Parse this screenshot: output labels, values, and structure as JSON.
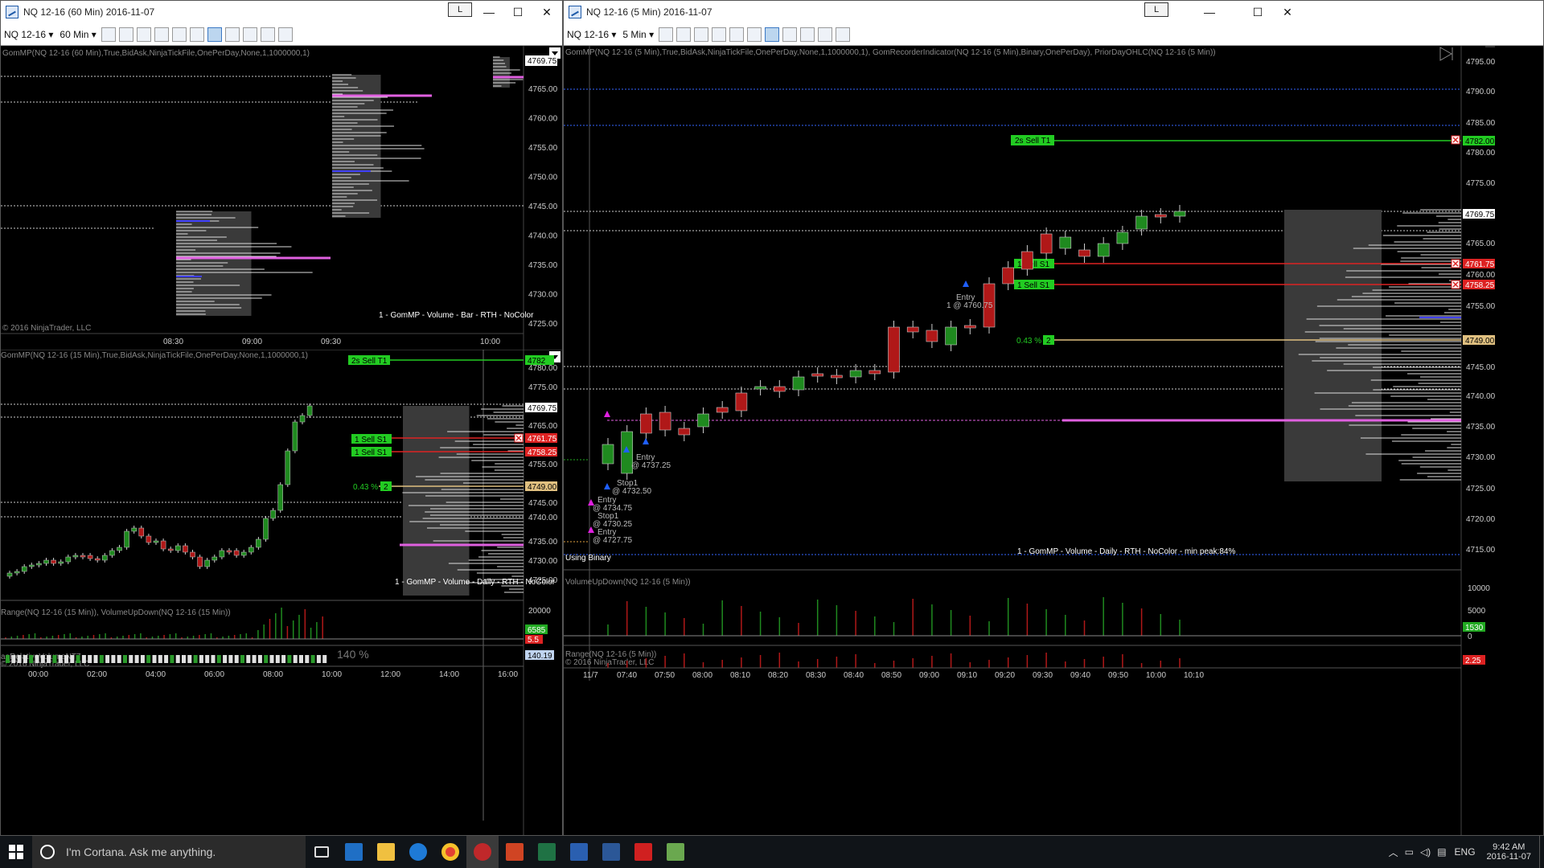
{
  "left_window": {
    "title": "NQ 12-16 (60 Min)  2016-11-07",
    "l_button": "L",
    "controls": {
      "min": "—",
      "max": "☐",
      "close": "✕"
    },
    "toolbar": {
      "instrument": "NQ 12-16",
      "interval": "60 Min"
    }
  },
  "right_window": {
    "title": "NQ 12-16 (5 Min)  2016-11-07",
    "l_button": "L",
    "controls": {
      "min": "—",
      "max": "☐",
      "close": "✕"
    },
    "toolbar": {
      "instrument": "NQ 12-16",
      "interval": "5 Min"
    }
  },
  "chart_60": {
    "indicator_label": "GomMP(NQ 12-16 (60 Min),True,BidAsk,NinjaTickFile,OnePerDay,None,1,1000000,1)",
    "copyright": "© 2016 NinjaTrader, LLC",
    "legend": "1 - GomMP  - Volume - Bar - RTH - NoColor",
    "price_labels": [
      "4765.00",
      "4760.00",
      "4755.00",
      "4750.00",
      "4745.00",
      "4740.00",
      "4735.00",
      "4730.00",
      "4725.00"
    ],
    "last_price": "4769.75",
    "time_labels": [
      "08:30",
      "09:00",
      "09:30",
      "10:00"
    ]
  },
  "chart_15": {
    "indicator_label": "GomMP(NQ 12-16 (15 Min),True,BidAsk,NinjaTickFile,OnePerDay,None,1,1000000,1)",
    "legend": "1 - GomMP  - Volume - Daily - RTH - NoColor",
    "price_labels": [
      "4780.00",
      "4775.00",
      "4765.00",
      "4755.00",
      "4745.00",
      "4740.00",
      "4735.00",
      "4730.00",
      "4725.00"
    ],
    "order_sell_t1": "2s  Sell T1",
    "order_sell_s1_a": "1  Sell S1",
    "order_sell_s1_b": "1  Sell S1",
    "tag_target": "4782",
    "tag_last": "4769.75",
    "tag_s1a": "4761.75",
    "tag_s1b": "4758.25",
    "tag_prev": "4749.00",
    "pct_label": "0.43 %",
    "pct_qty": "2",
    "sub_label": "Range(NQ 12-16 (15 Min)), VolumeUpDown(NQ 12-16 (15 Min))",
    "sub_axis": "20000",
    "sub_val1": "6585",
    "sub_val2": "5.5",
    "rel_label": "aeRelativeVolumeNT7",
    "rel_copy": "© 2016 NinjaTrader, LLC",
    "rel_pct": "140 %",
    "rel_val": "140.19",
    "time_labels": [
      "00:00",
      "02:00",
      "04:00",
      "06:00",
      "08:00",
      "10:00",
      "12:00",
      "14:00",
      "16:00"
    ]
  },
  "chart_5": {
    "indicator_label": "GomMP(NQ 12-16 (5 Min),True,BidAsk,NinjaTickFile,OnePerDay,None,1,1000000,1), GomRecorderIndicator(NQ 12-16 (5 Min),Binary,OnePerDay), PriorDayOHLC(NQ 12-16 (5 Min))",
    "price_labels": [
      "4795.00",
      "4790.00",
      "4785.00",
      "4780.00",
      "4775.00",
      "4765.00",
      "4760.00",
      "4755.00",
      "4745.00",
      "4740.00",
      "4735.00",
      "4730.00",
      "4725.00",
      "4720.00",
      "4715.00"
    ],
    "order_sell_t1": "2s  Sell T1",
    "order_sell_s1_a": "1  Sell S1",
    "order_sell_s1_b": "1  Sell S1",
    "tag_target": "4782.00",
    "tag_last": "4769.75",
    "tag_s1a": "4761.75",
    "tag_s1b": "4758.25",
    "tag_prev": "4749.00",
    "pct_label": "0.43 %",
    "pct_qty": "2",
    "annotations": [
      {
        "l1": "Entry",
        "l2": "1 @ 4760.75"
      },
      {
        "l1": "Entry",
        "l2": "@ 4737.25"
      },
      {
        "l1": "Stop1",
        "l2": "@ 4732.50"
      },
      {
        "l1": "Entry",
        "l2": "@ 4734.75"
      },
      {
        "l1": "Stop1",
        "l2": "@ 4730.25"
      },
      {
        "l1": "Entry",
        "l2": "@ 4727.75"
      }
    ],
    "using_binary": "Using Binary",
    "legend": "1 - GomMP  - Volume - Daily - RTH - NoColor - min peak:84%",
    "vol_label": "VolumeUpDown(NQ 12-16 (5 Min))",
    "vol_axis": [
      "10000",
      "5000",
      "0"
    ],
    "vol_val": "1530",
    "range_label": "Range(NQ 12-16 (5 Min))",
    "range_copy": "© 2016 NinjaTrader, LLC",
    "range_val": "2.25",
    "time_labels": [
      "11/7",
      "07:40",
      "07:50",
      "08:00",
      "08:10",
      "08:20",
      "08:30",
      "08:40",
      "08:50",
      "09:00",
      "09:10",
      "09:20",
      "09:30",
      "09:40",
      "09:50",
      "10:00",
      "10:10"
    ]
  },
  "taskbar": {
    "cortana": "I'm Cortana. Ask me anything.",
    "lang": "ENG",
    "time": "9:42 AM",
    "date": "2016-11-07"
  },
  "colors": {
    "bull": "#1f8a1f",
    "bear": "#b01818",
    "accent": "#e060e0",
    "order_green": "#22cc22",
    "order_red": "#dd2222"
  }
}
